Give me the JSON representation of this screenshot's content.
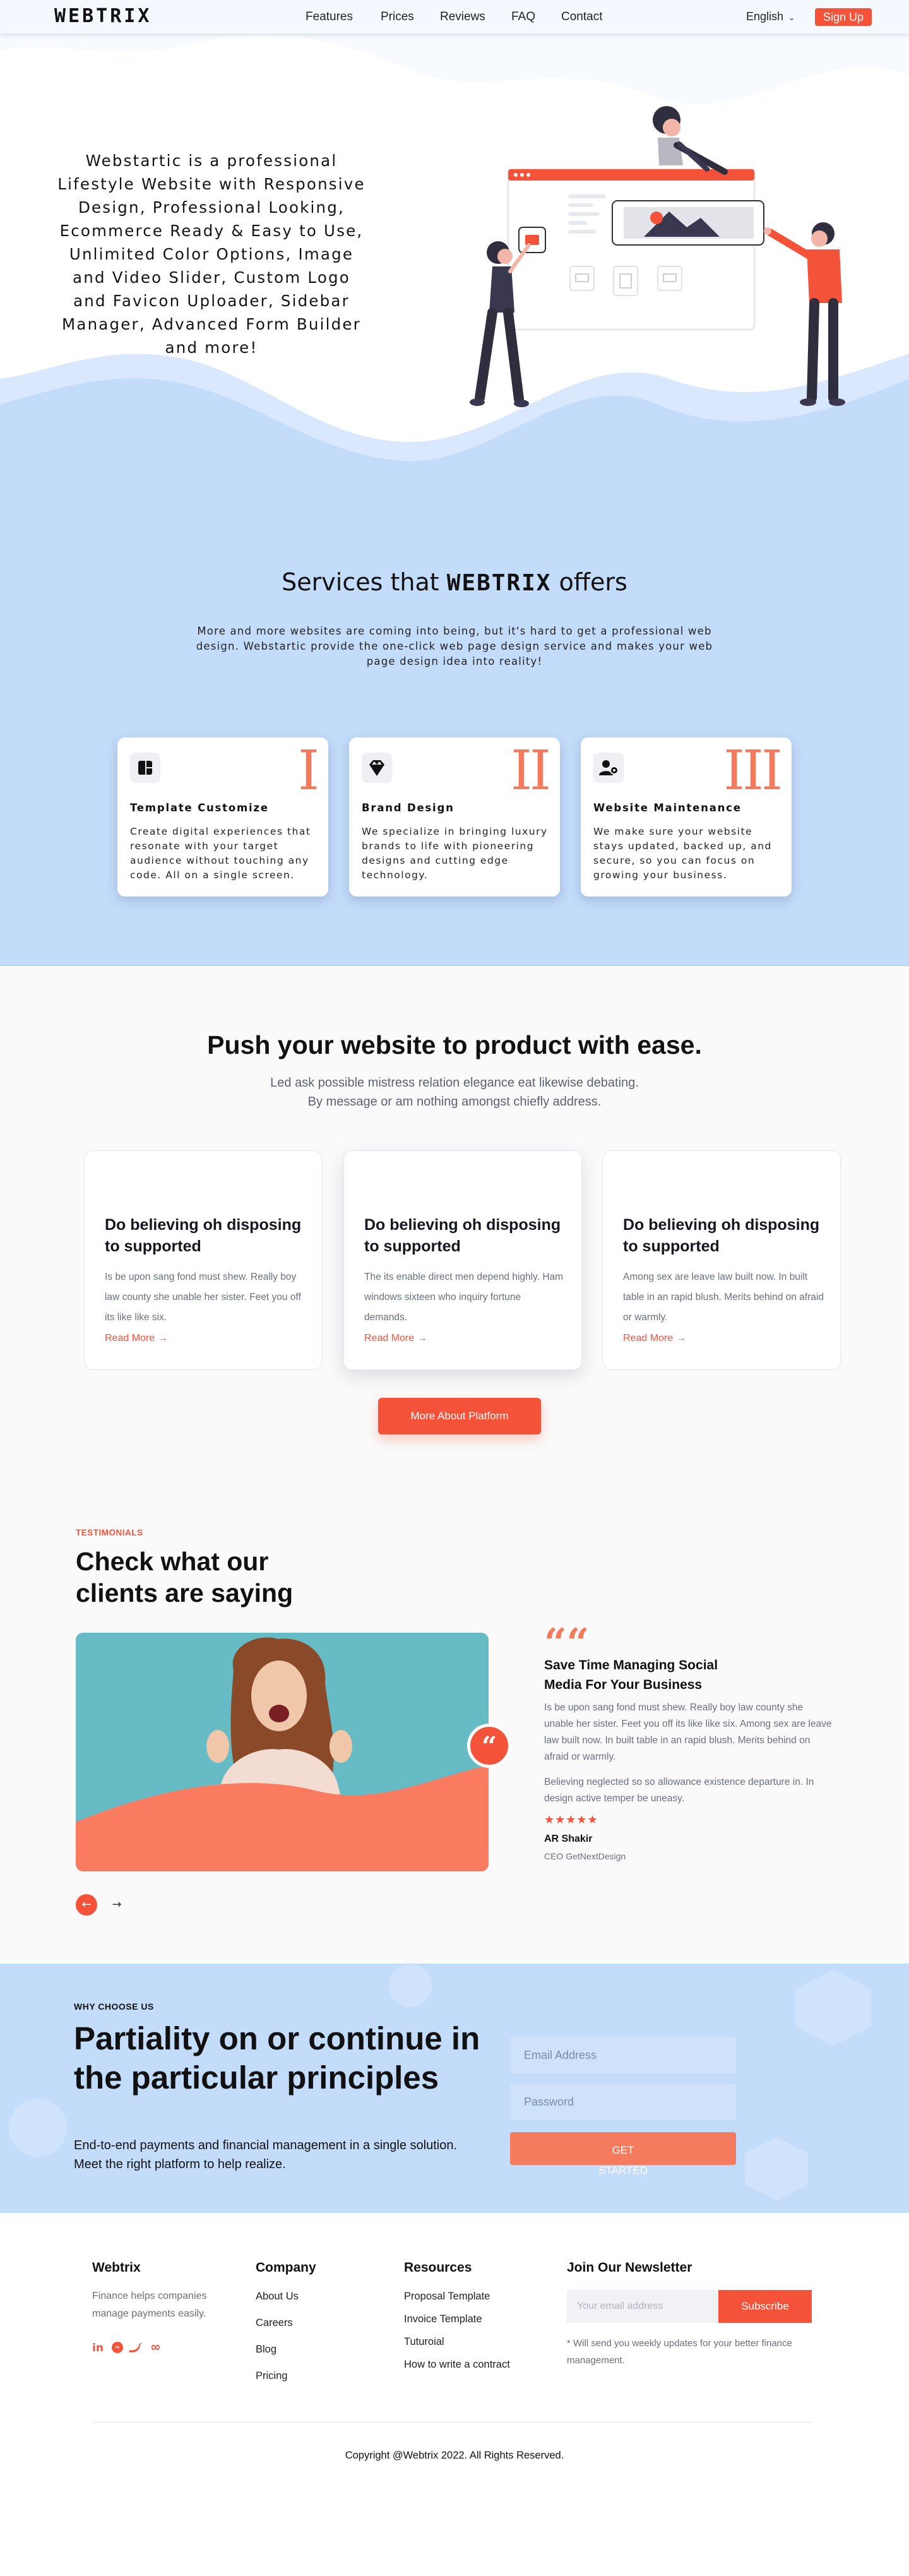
{
  "nav": {
    "logo": "WEBTRIX",
    "links": [
      "Features",
      "Prices",
      "Reviews",
      "FAQ",
      "Contact"
    ],
    "language": "English",
    "signup": "Sign Up"
  },
  "hero": {
    "text": "Webstartic is a professional Lifestyle Website with Responsive Design, Professional Looking, Ecommerce Ready & Easy to Use, Unlimited Color Options, Image and Video Slider, Custom Logo and Favicon Uploader, Sidebar Manager, Advanced Form Builder and more!"
  },
  "services": {
    "title_prefix": "Services that",
    "title_brand": "WEBTRIX",
    "title_suffix": "offers",
    "subtitle": "More and more websites are coming into being, but it's hard to get a professional web design. Webstartic provide the one-click web page design service and makes your web page design idea into reality!",
    "cards": [
      {
        "numeral": "I",
        "name": "Template Customize",
        "desc": "Create digital experiences that resonate with your target audience without touching any code. All on a single screen.",
        "icon": "grid-icon"
      },
      {
        "numeral": "II",
        "name": "Brand Design",
        "desc": "We specialize in bringing luxury brands to life with pioneering designs and cutting edge technology.",
        "icon": "diamond-icon"
      },
      {
        "numeral": "III",
        "name": "Website Maintenance",
        "desc": "We make sure your website stays updated, backed up, and secure, so you can focus on growing your business.",
        "icon": "user-gear-icon"
      }
    ]
  },
  "push": {
    "title": "Push your website to product with ease.",
    "subtitle_line1": "Led ask possible mistress relation elegance eat likewise debating.",
    "subtitle_line2": "By message or am nothing amongst chiefly address.",
    "cards": [
      {
        "title": "Do believing oh disposing to supported",
        "desc": "Is be upon sang fond must shew. Really boy law county she unable her sister. Feet you off its like like six.",
        "link": "Read More"
      },
      {
        "title": "Do believing oh disposing to supported",
        "desc": "The its enable direct men depend highly. Ham windows sixteen who inquiry fortune demands.",
        "link": "Read More"
      },
      {
        "title": "Do believing oh disposing to supported",
        "desc": "Among sex are leave law built now. In built table in an rapid blush. Merits behind on afraid or warmly.",
        "link": "Read More"
      }
    ],
    "button": "More About Platform"
  },
  "testimonials": {
    "label": "TESTIMONIALS",
    "title": "Check what our clients are saying",
    "quote_mark": "““",
    "heading": "Save Time Managing Social Media For Your Business",
    "body1": "Is be upon sang fond must shew. Really boy law county she unable her sister. Feet you off its like like six. Among sex are leave law built now. In built table in an rapid blush. Merits behind on afraid or warmly.",
    "body2": "Believing neglected so so allowance existence departure in. In design active temper be uneasy.",
    "stars": "★★★★★",
    "name": "AR Shakir",
    "role": "CEO GetNextDesign",
    "prev": "←",
    "next": "→"
  },
  "why": {
    "label": "WHY CHOOSE US",
    "title": "Partiality on or continue in the particular principles",
    "desc_line1": "End-to-end payments and financial management in a single solution.",
    "desc_line2": "Meet the right platform to help realize.",
    "email_placeholder": "Email Address",
    "password_placeholder": "Password",
    "button_line1": "GET",
    "button_line2": "STARTED"
  },
  "footer": {
    "brand": "Webtrix",
    "tagline": "Finance helps companies manage payments easily.",
    "company_head": "Company",
    "company_links": [
      "About Us",
      "Careers",
      "Blog",
      "Pricing"
    ],
    "resources_head": "Resources",
    "resources_links": [
      "Proposal Template",
      "Invoice Template",
      "Tuturoial",
      "How to write a contract"
    ],
    "newsletter_head": "Join Our Newsletter",
    "email_placeholder": "Your email address",
    "subscribe": "Subscribe",
    "note": "* Will send you weekly updates for your better finance management.",
    "copyright": "Copyright @Webtrix 2022. All Rights Reserved."
  },
  "colors": {
    "accent": "#f5523a",
    "accent_light": "#f37a5c",
    "hero_blue": "#c3dcfa",
    "text_dark": "#111111",
    "text_muted": "#6b6f7e"
  }
}
